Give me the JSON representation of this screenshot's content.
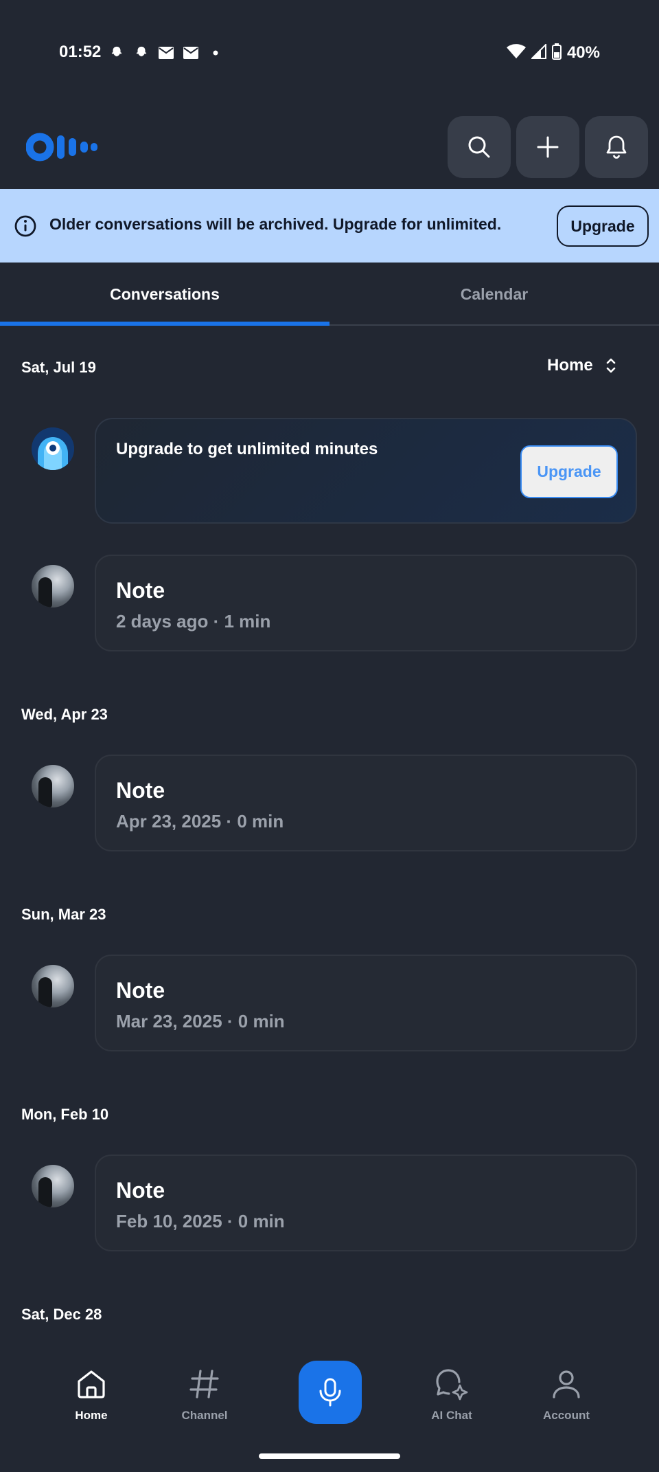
{
  "status_bar": {
    "time": "01:52",
    "left_icons": [
      "snapchat-icon",
      "snapchat-icon",
      "mail-icon",
      "mail-icon",
      "dot-icon"
    ],
    "battery": "40%"
  },
  "header": {
    "logo": "otter-logo",
    "buttons": [
      "search-icon",
      "plus-icon",
      "bell-icon"
    ]
  },
  "banner": {
    "text": "Older conversations will be archived. Upgrade for unlimited.",
    "button": "Upgrade"
  },
  "tabs": [
    {
      "label": "Conversations",
      "active": true
    },
    {
      "label": "Calendar",
      "active": false
    }
  ],
  "filter": {
    "label": "Home"
  },
  "groups": [
    {
      "date": "Sat, Jul 19"
    },
    {
      "date": "Wed, Apr 23"
    },
    {
      "date": "Sun, Mar 23"
    },
    {
      "date": "Mon, Feb 10"
    },
    {
      "date": "Sat, Dec 28"
    }
  ],
  "promo": {
    "title": "Upgrade to get unlimited minutes",
    "button": "Upgrade"
  },
  "conversations": [
    {
      "title": "Note",
      "meta": "2 days ago · 1 min"
    },
    {
      "title": "Note",
      "meta": "Apr 23, 2025 · 0 min"
    },
    {
      "title": "Note",
      "meta": "Mar 23, 2025 · 0 min"
    },
    {
      "title": "Note",
      "meta": "Feb 10, 2025 · 0 min"
    }
  ],
  "bottom_nav": [
    {
      "label": "Home",
      "icon": "home-icon",
      "active": true
    },
    {
      "label": "Channel",
      "icon": "hash-icon",
      "active": false
    },
    {
      "label": "AI Chat",
      "icon": "ai-chat-icon",
      "active": false
    },
    {
      "label": "Account",
      "icon": "person-icon",
      "active": false
    }
  ],
  "colors": {
    "background": "#222732",
    "accent": "#1a73e8",
    "banner": "#b7d6fe"
  }
}
